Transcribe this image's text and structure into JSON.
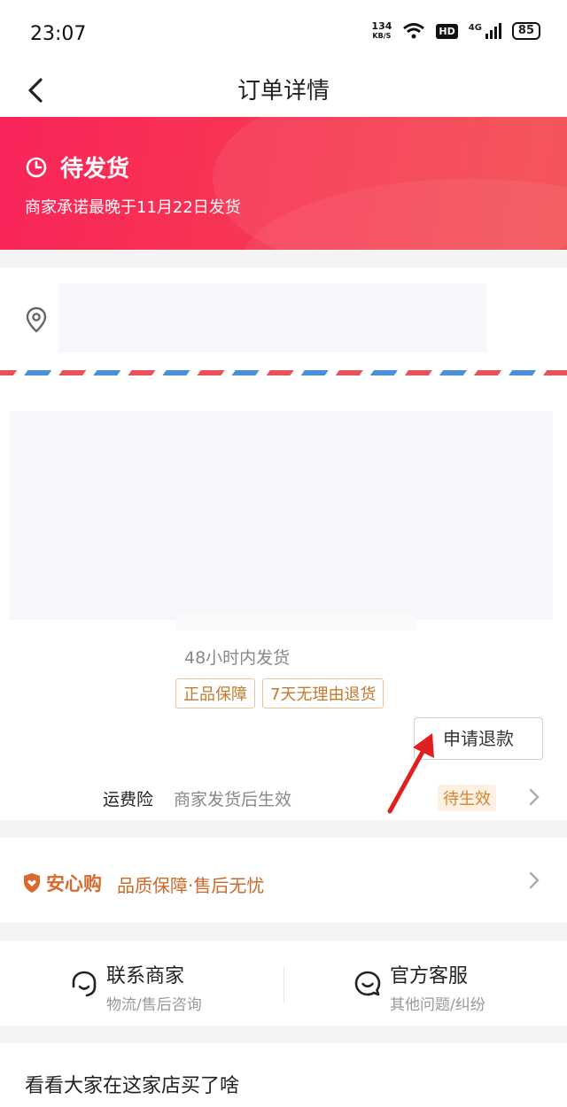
{
  "status_bar": {
    "time": "23:07",
    "speed_value": "134",
    "speed_unit": "KB/S",
    "hd": "HD",
    "network": "4G",
    "battery": "85"
  },
  "nav": {
    "title": "订单详情",
    "back_icon": "chevron-left-icon"
  },
  "order_status": {
    "icon": "clock-icon",
    "title": "待发货",
    "subtitle": "商家承诺最晚于11月22日发货",
    "gradient": [
      "#f8245a",
      "#f34a4e"
    ]
  },
  "address": {
    "icon": "location-pin-icon"
  },
  "product": {
    "ship_note": "48小时内发货",
    "tags": [
      "正品保障",
      "7天无理由退货"
    ],
    "refund_button": "申请退款",
    "freight": {
      "label": "运费险",
      "desc": "商家发货后生效",
      "status": "待生效"
    }
  },
  "assurance": {
    "brand": "安心购",
    "text": "品质保障·售后无忧",
    "color": "#d9692c"
  },
  "contact": {
    "merchant": {
      "title": "联系商家",
      "sub": "物流/售后咨询"
    },
    "service": {
      "title": "官方客服",
      "sub": "其他问题/纠纷"
    }
  },
  "recommend": {
    "title": "看看大家在这家店买了啥"
  },
  "colors": {
    "accent_red": "#f8245a",
    "tag_orange": "#c27a2c",
    "annotation_arrow": "#e02020"
  }
}
